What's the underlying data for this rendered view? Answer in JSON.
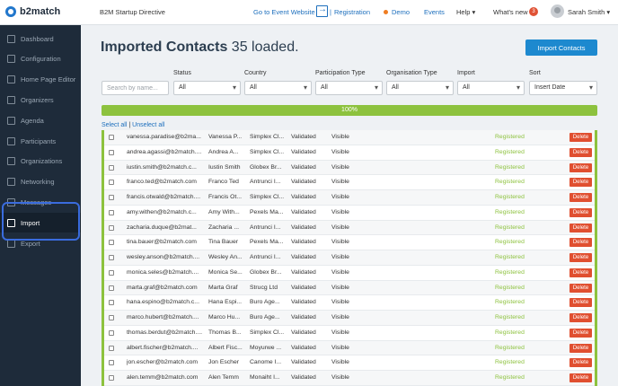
{
  "header": {
    "logo": "b2match",
    "event_name": "B2M Startup Directive",
    "go_to_event": "Go to Event Website",
    "registration": "Registration",
    "demo": "Demo",
    "events": "Events",
    "help": "Help",
    "whats_new": "What's new",
    "whats_new_count": "3",
    "user_name": "Sarah Smith"
  },
  "sidebar": {
    "items": [
      {
        "label": "Dashboard",
        "icon": "dashboard-icon"
      },
      {
        "label": "Configuration",
        "icon": "config-icon"
      },
      {
        "label": "Home Page Editor",
        "icon": "home-page-icon"
      },
      {
        "label": "Organizers",
        "icon": "organizers-icon"
      },
      {
        "label": "Agenda",
        "icon": "agenda-icon"
      },
      {
        "label": "Participants",
        "icon": "participants-icon"
      },
      {
        "label": "Organizations",
        "icon": "organizations-icon"
      },
      {
        "label": "Networking",
        "icon": "networking-icon"
      },
      {
        "label": "Messages",
        "icon": "messages-icon"
      },
      {
        "label": "Import",
        "icon": "import-icon",
        "active": true
      },
      {
        "label": "Export",
        "icon": "export-icon"
      }
    ]
  },
  "main": {
    "title": "Imported Contacts",
    "subtitle": "35 loaded.",
    "import_button": "Import Contacts",
    "search_placeholder": "Search by name...",
    "filters": [
      {
        "label": "Status",
        "value": "All"
      },
      {
        "label": "Country",
        "value": "All"
      },
      {
        "label": "Participation Type",
        "value": "All"
      },
      {
        "label": "Organisation Type",
        "value": "All"
      },
      {
        "label": "Import",
        "value": "All"
      },
      {
        "label": "Sort",
        "value": "Insert Date"
      }
    ],
    "progress": "100%",
    "progress_value": 100,
    "select_all": "Select all",
    "separator": "|",
    "unselect_all": "Unselect all",
    "delete_label": "Delete",
    "rows": [
      {
        "email": "vanessa.paradise@b2ma...",
        "name": "Vanessa P...",
        "org": "Simplex Cl...",
        "validation": "Validated",
        "visibility": "Visible",
        "status": "Registered"
      },
      {
        "email": "andrea.agassi@b2match....",
        "name": "Andrea A...",
        "org": "Simplex Cl...",
        "validation": "Validated",
        "visibility": "Visible",
        "status": "Registered"
      },
      {
        "email": "iustin.smith@b2match.c...",
        "name": "Iustin Smith",
        "org": "Globex Br...",
        "validation": "Validated",
        "visibility": "Visible",
        "status": "Registered"
      },
      {
        "email": "franco.ted@b2match.com",
        "name": "Franco Ted",
        "org": "Antrunci I...",
        "validation": "Validated",
        "visibility": "Visible",
        "status": "Registered"
      },
      {
        "email": "francis.otwald@b2match....",
        "name": "Francis Ot...",
        "org": "Simplex Cl...",
        "validation": "Validated",
        "visibility": "Visible",
        "status": "Registered"
      },
      {
        "email": "amy.withen@b2match.c...",
        "name": "Amy With...",
        "org": "Pexels Ma...",
        "validation": "Validated",
        "visibility": "Visible",
        "status": "Registered"
      },
      {
        "email": "zacharia.duque@b2mat...",
        "name": "Zacharia ...",
        "org": "Antrunci I...",
        "validation": "Validated",
        "visibility": "Visible",
        "status": "Registered"
      },
      {
        "email": "tina.bauer@b2match.com",
        "name": "Tina Bauer",
        "org": "Pexels Ma...",
        "validation": "Validated",
        "visibility": "Visible",
        "status": "Registered"
      },
      {
        "email": "wesley.anson@b2match....",
        "name": "Wesley An...",
        "org": "Antrunci I...",
        "validation": "Validated",
        "visibility": "Visible",
        "status": "Registered"
      },
      {
        "email": "monica.seles@b2match....",
        "name": "Monica Se...",
        "org": "Globex Br...",
        "validation": "Validated",
        "visibility": "Visible",
        "status": "Registered"
      },
      {
        "email": "marta.graf@b2match.com",
        "name": "Marta Graf",
        "org": "Strucg Ltd",
        "validation": "Validated",
        "visibility": "Visible",
        "status": "Registered"
      },
      {
        "email": "hana.espino@b2match.c...",
        "name": "Hana Espi...",
        "org": "Buro Age...",
        "validation": "Validated",
        "visibility": "Visible",
        "status": "Registered"
      },
      {
        "email": "marco.hubert@b2match....",
        "name": "Marco Hu...",
        "org": "Buro Age...",
        "validation": "Validated",
        "visibility": "Visible",
        "status": "Registered"
      },
      {
        "email": "thomas.berdut@b2match....",
        "name": "Thomas B...",
        "org": "Simplex Cl...",
        "validation": "Validated",
        "visibility": "Visible",
        "status": "Registered"
      },
      {
        "email": "albert.fischer@b2match....",
        "name": "Albert Fisc...",
        "org": "Moyurwe ...",
        "validation": "Validated",
        "visibility": "Visible",
        "status": "Registered"
      },
      {
        "email": "jon.escher@b2match.com",
        "name": "Jon Escher",
        "org": "Canome I...",
        "validation": "Validated",
        "visibility": "Visible",
        "status": "Registered"
      },
      {
        "email": "alen.temm@b2match.com",
        "name": "Alen Temm",
        "org": "Monaiht I...",
        "validation": "Validated",
        "visibility": "Visible",
        "status": "Registered"
      }
    ]
  },
  "colors": {
    "sidebar_bg": "#1e2b3a",
    "accent_blue": "#1d89cf",
    "progress_green": "#8dc23e",
    "delete_red": "#e04f30",
    "highlight": "#3a6cde"
  }
}
